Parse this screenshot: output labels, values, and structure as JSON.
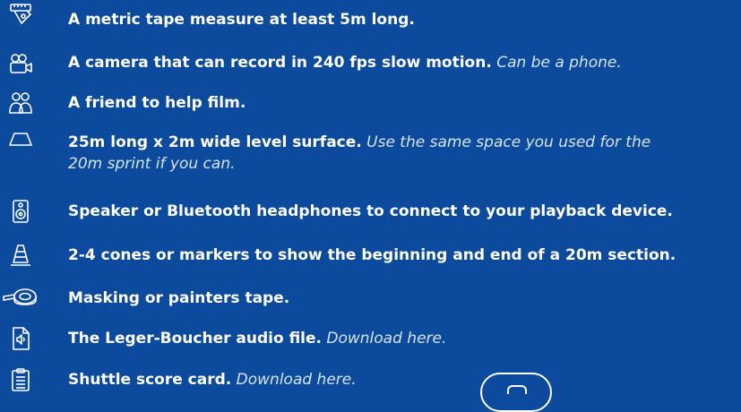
{
  "items": [
    {
      "icon": "tape-measure-icon",
      "label": "A metric tape measure at least 5m long.",
      "note": ""
    },
    {
      "icon": "camera-icon",
      "label": "A camera that can record in 240 fps slow motion.",
      "note": "Can be a phone."
    },
    {
      "icon": "people-icon",
      "label": "A friend to help film.",
      "note": ""
    },
    {
      "icon": "surface-icon",
      "label": "25m long x 2m wide level surface.",
      "note": "Use the same space you used for the 20m sprint if you can."
    },
    {
      "icon": "speaker-icon",
      "label": "Speaker or Bluetooth headphones to connect to your playback device.",
      "note": ""
    },
    {
      "icon": "cone-icon",
      "label": "2-4 cones or markers to show the beginning and end of a 20m section.",
      "note": ""
    },
    {
      "icon": "masking-tape-icon",
      "label": "Masking or painters tape.",
      "note": ""
    },
    {
      "icon": "audio-file-icon",
      "label": "The Leger-Boucher audio file.",
      "note": "Download here."
    },
    {
      "icon": "clipboard-icon",
      "label": "Shuttle score card.",
      "note": "Download here."
    }
  ],
  "colors": {
    "background": "#0b4a9c",
    "text": "#ffffff",
    "note": "#d7e4f5"
  }
}
